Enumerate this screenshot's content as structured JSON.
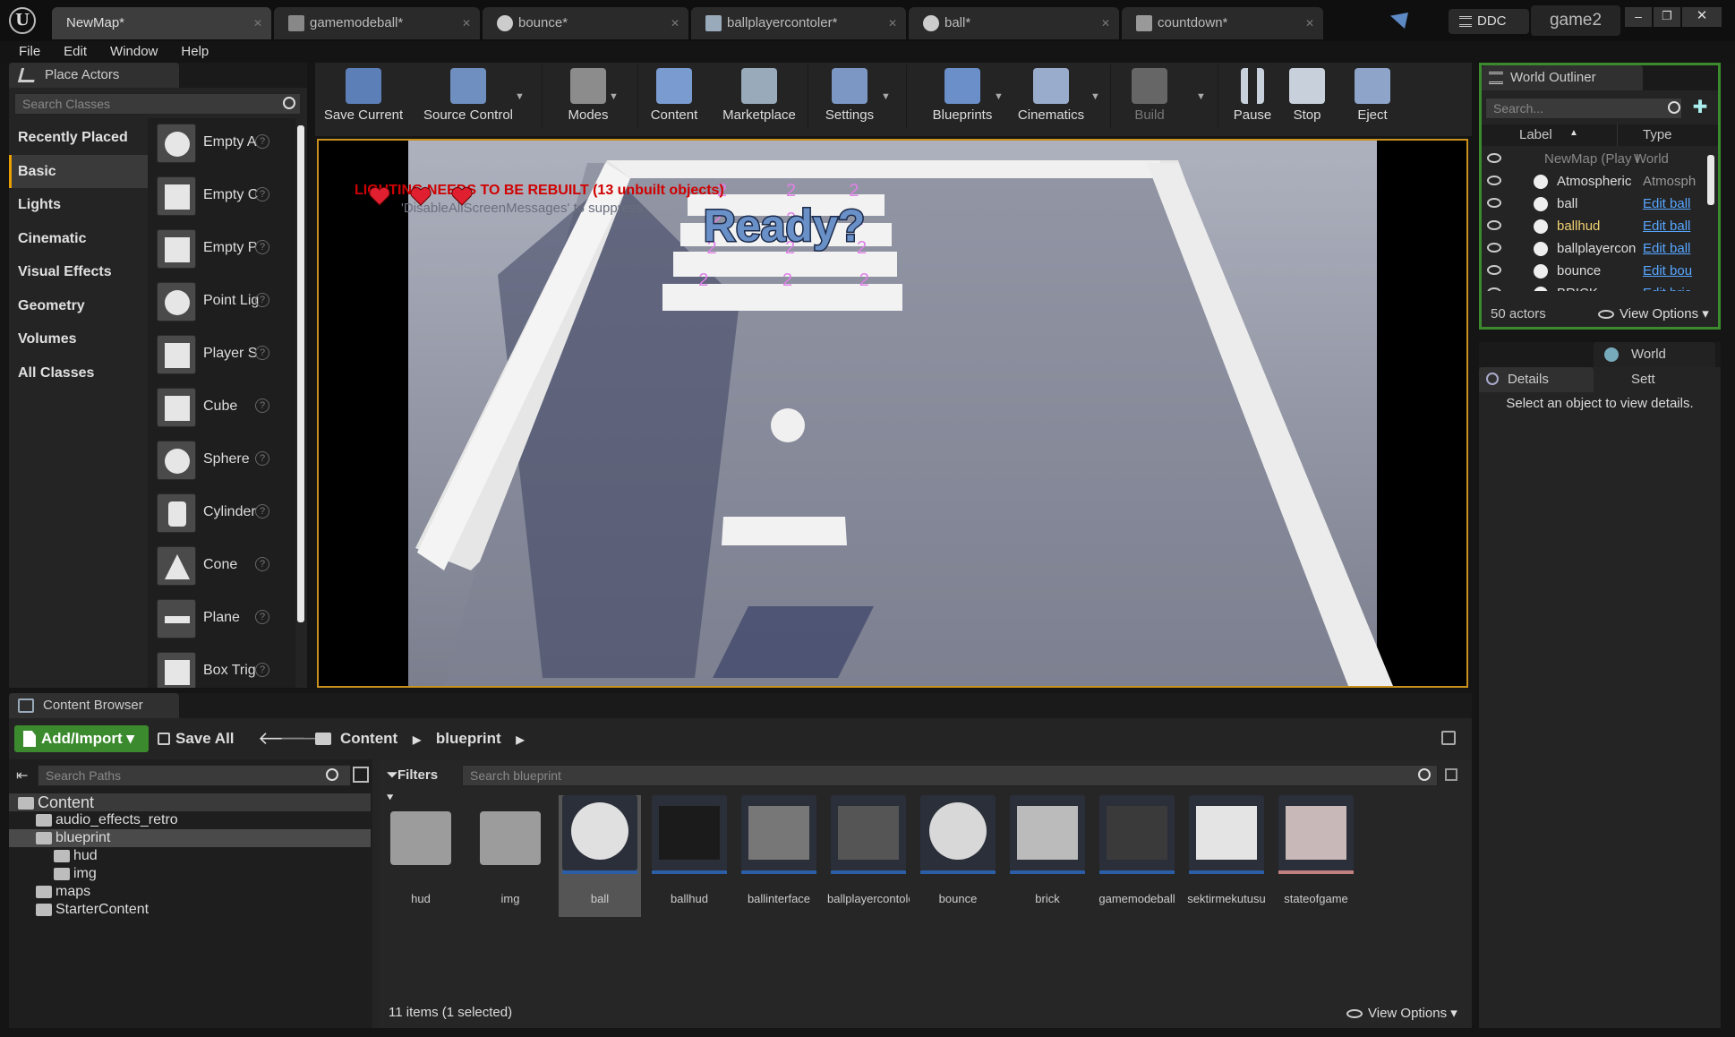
{
  "tabs": [
    {
      "label": "NewMap*"
    },
    {
      "label": "gamemodeball*"
    },
    {
      "label": "bounce*"
    },
    {
      "label": "ballplayercontoler*"
    },
    {
      "label": "ball*"
    },
    {
      "label": "countdown*"
    }
  ],
  "titlebar": {
    "ddc": "DDC",
    "project": "game2",
    "logo": "U"
  },
  "menu": [
    "File",
    "Edit",
    "Window",
    "Help"
  ],
  "place_actors": {
    "title": "Place Actors",
    "search_placeholder": "Search Classes",
    "categories": [
      "Recently Placed",
      "Basic",
      "Lights",
      "Cinematic",
      "Visual Effects",
      "Geometry",
      "Volumes",
      "All Classes"
    ],
    "selected_category": "Basic",
    "items": [
      "Empty A",
      "Empty C",
      "Empty P",
      "Point Lig",
      "Player S",
      "Cube",
      "Sphere",
      "Cylinder",
      "Cone",
      "Plane",
      "Box Trig"
    ]
  },
  "toolbar": [
    {
      "label": "Save Current",
      "icon": "save-icon"
    },
    {
      "label": "Source Control",
      "icon": "source-control-icon"
    },
    {
      "label": "Modes",
      "icon": "modes-icon"
    },
    {
      "label": "Content",
      "icon": "content-icon"
    },
    {
      "label": "Marketplace",
      "icon": "marketplace-icon"
    },
    {
      "label": "Settings",
      "icon": "settings-icon"
    },
    {
      "label": "Blueprints",
      "icon": "blueprints-icon"
    },
    {
      "label": "Cinematics",
      "icon": "cinematics-icon"
    },
    {
      "label": "Build",
      "icon": "build-icon"
    },
    {
      "label": "Pause",
      "icon": "pause-icon"
    },
    {
      "label": "Stop",
      "icon": "stop-icon"
    },
    {
      "label": "Eject",
      "icon": "eject-icon"
    }
  ],
  "viewport": {
    "lighting_warning": "LIGHTING NEEDS TO BE REBUILT (13 unbuilt objects)",
    "suppress_msg": "'DisableAllScreenMessages' to suppress",
    "ready_text": "Ready?",
    "brick_number": "2"
  },
  "outliner": {
    "title": "World Outliner",
    "search_placeholder": "Search...",
    "col_label": "Label",
    "col_type": "Type",
    "rows": [
      {
        "label": "NewMap (Play I",
        "type": "World"
      },
      {
        "label": "Atmospheric",
        "type": "Atmosph"
      },
      {
        "label": "ball",
        "type": "Edit ball"
      },
      {
        "label": "ballhud",
        "type": "Edit ball"
      },
      {
        "label": "ballplayercon",
        "type": "Edit ball"
      },
      {
        "label": "bounce",
        "type": "Edit bou"
      },
      {
        "label": "BRICK",
        "type": "Edit bric"
      }
    ],
    "count": "50 actors",
    "view_options": "View Options"
  },
  "details": {
    "tab1": "Details",
    "tab2": "World Sett",
    "empty_msg": "Select an object to view details."
  },
  "content_browser": {
    "title": "Content Browser",
    "add_import": "Add/Import",
    "save_all": "Save All",
    "breadcrumb": [
      "Content",
      "blueprint"
    ],
    "search_paths": "Search Paths",
    "filters": "Filters",
    "search_blueprint": "Search blueprint",
    "tree": [
      {
        "label": "Content",
        "indent": 0
      },
      {
        "label": "audio_effects_retro",
        "indent": 1
      },
      {
        "label": "blueprint",
        "indent": 1
      },
      {
        "label": "hud",
        "indent": 2
      },
      {
        "label": "img",
        "indent": 2
      },
      {
        "label": "maps",
        "indent": 1
      },
      {
        "label": "StarterContent",
        "indent": 1
      }
    ],
    "assets": [
      "hud",
      "img",
      "ball",
      "ballhud",
      "ballinterface",
      "ballplayercontoler",
      "bounce",
      "brick",
      "gamemodeball",
      "sektirmekutusu",
      "stateofgame"
    ],
    "status": "11 items (1 selected)",
    "view_options": "View Options"
  },
  "colors": {
    "accent": "#c8901c",
    "link": "#58a6ff",
    "green": "#3c8a2e",
    "warning_red": "#d00000",
    "score_pink": "#e080e8"
  }
}
